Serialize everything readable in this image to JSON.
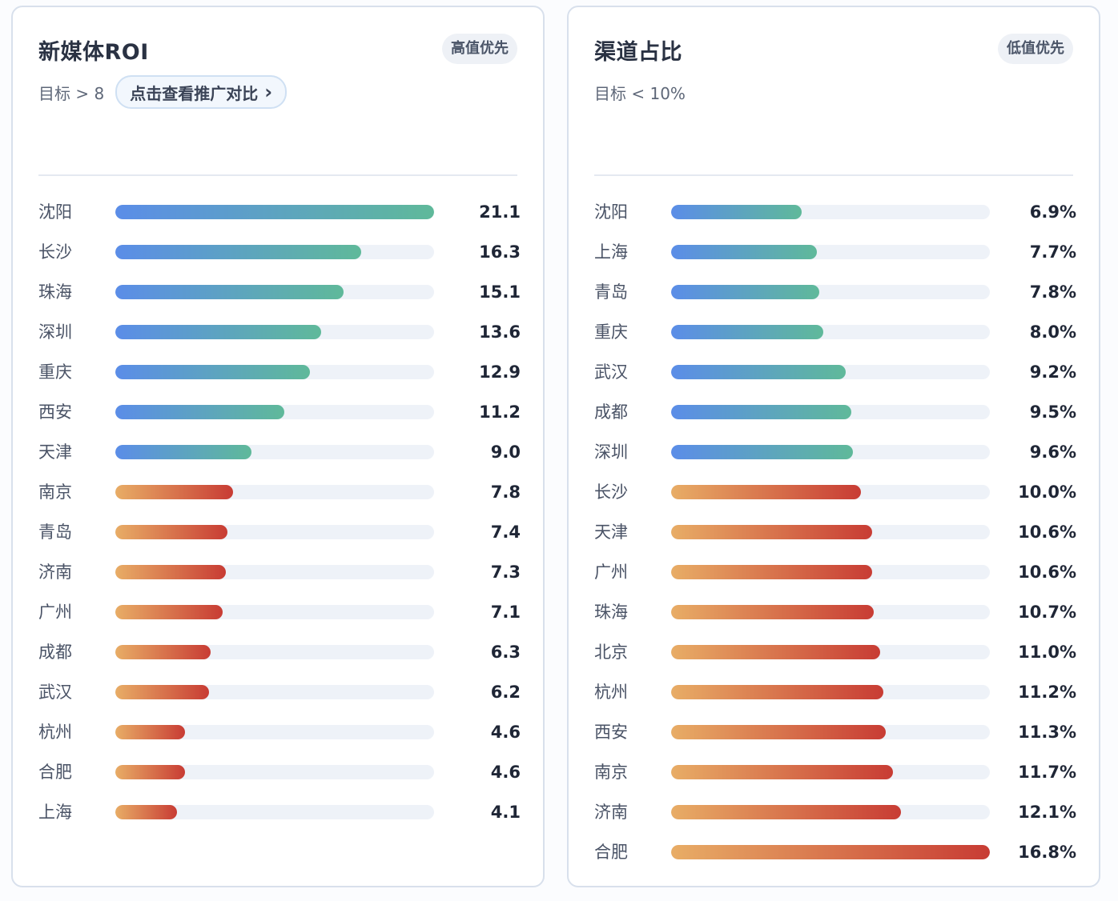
{
  "cards": [
    {
      "title": "新媒体ROI",
      "badge": "高值优先",
      "target": "目标 > 8",
      "compare_button": "点击查看推广对比",
      "chart_data": {
        "type": "bar",
        "orientation": "horizontal",
        "title": "新媒体ROI",
        "categories": [
          "沈阳",
          "长沙",
          "珠海",
          "深圳",
          "重庆",
          "西安",
          "天津",
          "南京",
          "青岛",
          "济南",
          "广州",
          "成都",
          "武汉",
          "杭州",
          "合肥",
          "上海"
        ],
        "values": [
          21.1,
          16.3,
          15.1,
          13.6,
          12.9,
          11.2,
          9.0,
          7.8,
          7.4,
          7.3,
          7.1,
          6.3,
          6.2,
          4.6,
          4.6,
          4.1
        ],
        "value_labels": [
          "21.1",
          "16.3",
          "15.1",
          "13.6",
          "12.9",
          "11.2",
          "9.0",
          "7.8",
          "7.4",
          "7.3",
          "7.1",
          "6.3",
          "6.2",
          "4.6",
          "4.6",
          "4.1"
        ],
        "xlim": [
          0,
          21.1
        ],
        "threshold": 8,
        "better": "higher",
        "colors": {
          "meets_target": [
            "#5b8de8",
            "#5fb99a"
          ],
          "misses_target": [
            "#e8ad66",
            "#c83c34"
          ]
        }
      }
    },
    {
      "title": "渠道占比",
      "badge": "低值优先",
      "target": "目标 < 10%",
      "chart_data": {
        "type": "bar",
        "orientation": "horizontal",
        "title": "渠道占比",
        "categories": [
          "沈阳",
          "上海",
          "青岛",
          "重庆",
          "武汉",
          "成都",
          "深圳",
          "长沙",
          "天津",
          "广州",
          "珠海",
          "北京",
          "杭州",
          "西安",
          "南京",
          "济南",
          "合肥"
        ],
        "values": [
          6.9,
          7.7,
          7.8,
          8.0,
          9.2,
          9.5,
          9.6,
          10.0,
          10.6,
          10.6,
          10.7,
          11.0,
          11.2,
          11.3,
          11.7,
          12.1,
          16.8
        ],
        "value_labels": [
          "6.9%",
          "7.7%",
          "7.8%",
          "8.0%",
          "9.2%",
          "9.5%",
          "9.6%",
          "10.0%",
          "10.6%",
          "10.6%",
          "10.7%",
          "11.0%",
          "11.2%",
          "11.3%",
          "11.7%",
          "12.1%",
          "16.8%"
        ],
        "xlim": [
          0,
          16.8
        ],
        "threshold": 10,
        "better": "lower",
        "colors": {
          "meets_target": [
            "#5b8de8",
            "#5fb99a"
          ],
          "misses_target": [
            "#e8ad66",
            "#c83c34"
          ]
        }
      }
    }
  ]
}
